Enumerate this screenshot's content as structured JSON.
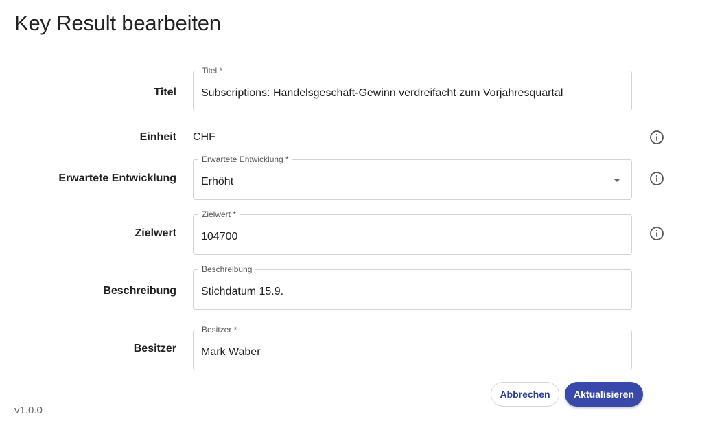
{
  "page": {
    "title": "Key Result bearbeiten"
  },
  "form": {
    "title": {
      "row_label": "Titel",
      "legend": "Titel *",
      "value": "Subscriptions: Handelsgeschäft-Gewinn verdreifacht zum Vorjahresquartal"
    },
    "unit": {
      "row_label": "Einheit",
      "value": "CHF"
    },
    "expected_trend": {
      "row_label": "Erwartete Entwicklung",
      "legend": "Erwartete Entwicklung *",
      "value": "Erhöht"
    },
    "target": {
      "row_label": "Zielwert",
      "legend": "Zielwert *",
      "value": "104700"
    },
    "description": {
      "row_label": "Beschreibung",
      "legend": "Beschreibung",
      "value": "Stichdatum 15.9."
    },
    "owner": {
      "row_label": "Besitzer",
      "legend": "Besitzer *",
      "value": "Mark Waber"
    }
  },
  "actions": {
    "cancel_label": "Abbrechen",
    "update_label": "Aktualisieren"
  },
  "footer": {
    "version": "v1.0.0"
  },
  "icons": {
    "info": "info-circle-icon",
    "dropdown": "chevron-down-icon"
  },
  "colors": {
    "primary": "#3949ab",
    "primary_text": "#2c3e9e",
    "border": "#d3d3d3"
  }
}
